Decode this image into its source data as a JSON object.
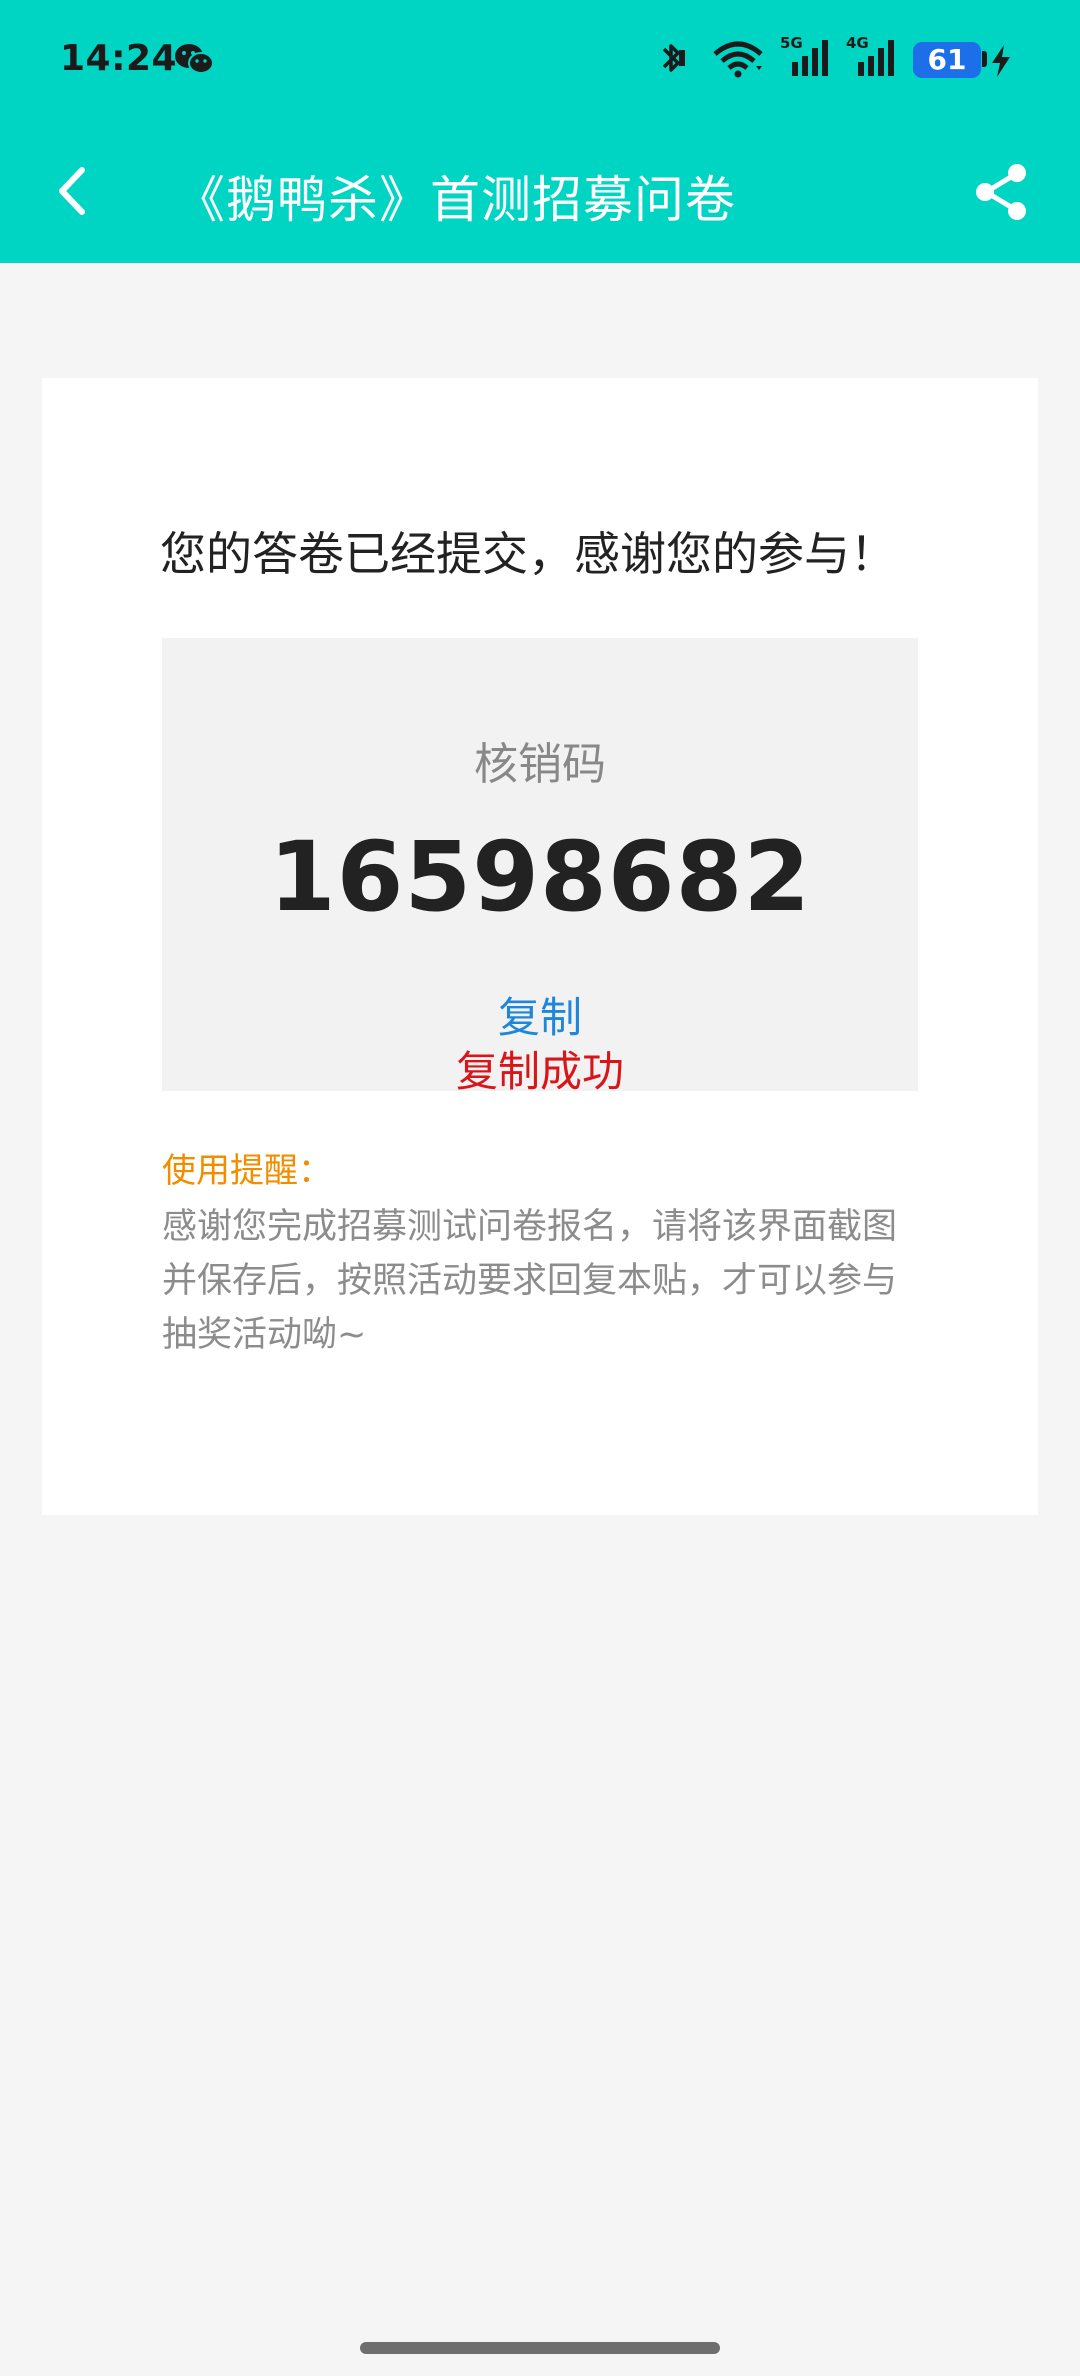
{
  "status_bar": {
    "time": "14:24",
    "battery_level": "61",
    "icons": [
      "wechat-icon",
      "bluetooth-icon",
      "wifi-icon",
      "signal-5g-icon",
      "signal-4g-icon",
      "battery-icon",
      "charging-icon"
    ],
    "signal_5g_label": "5G",
    "signal_4g_label": "4G"
  },
  "app_bar": {
    "title": "《鹅鸭杀》首测招募问卷",
    "back_icon": "chevron-left-icon",
    "share_icon": "share-icon"
  },
  "main": {
    "submitted_message": "您的答卷已经提交，感谢您的参与！",
    "code_label": "核销码",
    "code_value": "16598682",
    "copy_label": "复制",
    "copy_success": "复制成功",
    "reminder_title": "使用提醒：",
    "reminder_text": "感谢您完成招募测试问卷报名，请将该界面截图并保存后，按照活动要求回复本贴，才可以参与抽奖活动呦~"
  },
  "colors": {
    "accent": "#00d4c3",
    "copy_link": "#1e87d9",
    "success": "#d8161a",
    "reminder": "#f08e00",
    "battery": "#1c6fe8"
  }
}
